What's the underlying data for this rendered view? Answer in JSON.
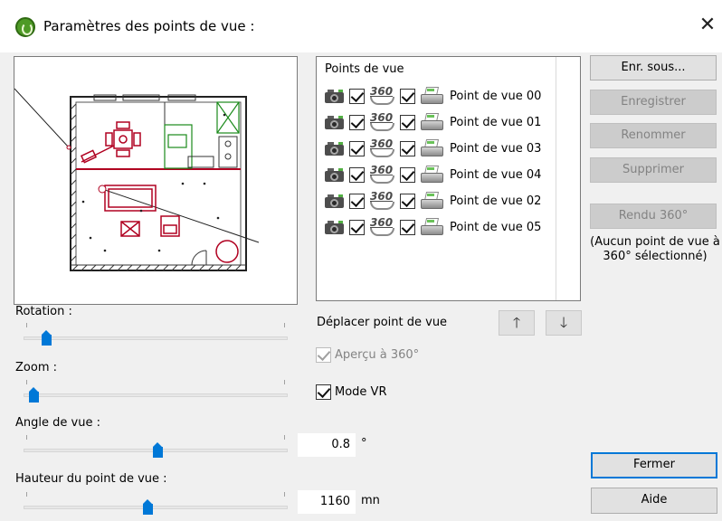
{
  "window": {
    "title": "Paramètres des points de vue :",
    "close_glyph": "✕",
    "app_icon": "app-logo-icon"
  },
  "viewpoints": {
    "header": "Points de vue",
    "items": [
      {
        "label": "Point de vue 00",
        "visible": true,
        "pano360": true
      },
      {
        "label": "Point de vue 01",
        "visible": true,
        "pano360": true
      },
      {
        "label": "Point de vue 03",
        "visible": true,
        "pano360": true
      },
      {
        "label": "Point de vue 04",
        "visible": true,
        "pano360": true
      },
      {
        "label": "Point de vue 02",
        "visible": true,
        "pano360": true
      },
      {
        "label": "Point de vue 05",
        "visible": true,
        "pano360": true
      }
    ],
    "icon_360_text": "360"
  },
  "buttons": {
    "save_as": "Enr. sous...",
    "save": "Enregistrer",
    "rename": "Renommer",
    "delete": "Supprimer",
    "render360": "Rendu 360°",
    "close": "Fermer",
    "help": "Aide"
  },
  "render_note": "(Aucun point de vue à 360° sélectionné)",
  "move": {
    "label": "Déplacer point de vue",
    "up_glyph": "🡑",
    "down_glyph": "🡓"
  },
  "options": {
    "preview360": {
      "label": "Aperçu à 360°",
      "checked": true,
      "enabled": false
    },
    "vr_mode": {
      "label": "Mode VR",
      "checked": true,
      "enabled": true
    }
  },
  "sliders": {
    "rotation": {
      "label": "Rotation :",
      "position": 0.07
    },
    "zoom": {
      "label": "Zoom :",
      "position": 0.02
    },
    "view_angle": {
      "label": "Angle de vue :",
      "position": 0.51,
      "value": "0.8",
      "unit": "°"
    },
    "viewpoint_height": {
      "label": "Hauteur du point de vue :",
      "position": 0.47,
      "value": "1160",
      "unit": "mn"
    }
  },
  "colors": {
    "accent": "#0078d7",
    "disabled_text": "#838383",
    "plan_red": "#b00020",
    "plan_green": "#1a8a1a"
  }
}
